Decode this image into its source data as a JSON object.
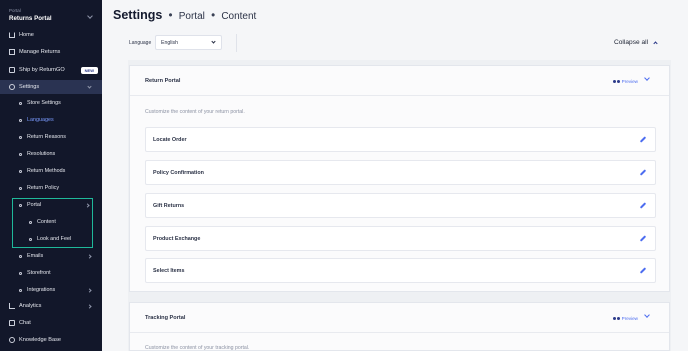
{
  "sidebar": {
    "brand_sub": "Portal",
    "brand_name": "Returns Portal",
    "home": "Home",
    "manage_returns": "Manage Returns",
    "ship": "Ship by ReturnGO",
    "new_badge": "NEW",
    "settings": "Settings",
    "settings_children": [
      "Store Settings",
      "Languages",
      "Return Reasons",
      "Resolutions",
      "Return Methods",
      "Return Policy",
      "Portal"
    ],
    "portal_children": [
      "Content",
      "Look and Feel"
    ],
    "emails": "Emails",
    "storefront": "Storefront",
    "integrations": "Integrations",
    "analytics": "Analytics",
    "chat": "Chat",
    "knowledge_base": "Knowledge Base"
  },
  "header": {
    "title": "Settings",
    "crumb1": "Portal",
    "crumb2": "Content",
    "separator": "•"
  },
  "toolbar": {
    "language_label": "Language",
    "language_value": "English",
    "collapse_all": "Collapse all"
  },
  "panels": {
    "return_portal": {
      "title": "Return Portal",
      "preview": "Preview",
      "description": "Customize the content of your return portal.",
      "rows": [
        "Locate Order",
        "Policy Confirmation",
        "Gift Returns",
        "Product Exchange",
        "Select Items"
      ]
    },
    "tracking_portal": {
      "title": "Tracking Portal",
      "preview": "Preview",
      "description": "Customize the content of your tracking portal."
    }
  },
  "colors": {
    "sidebar_bg": "#12172a",
    "active_bg": "#2a3352",
    "accent": "#4d6df0",
    "highlight_border": "#1fb99a"
  }
}
